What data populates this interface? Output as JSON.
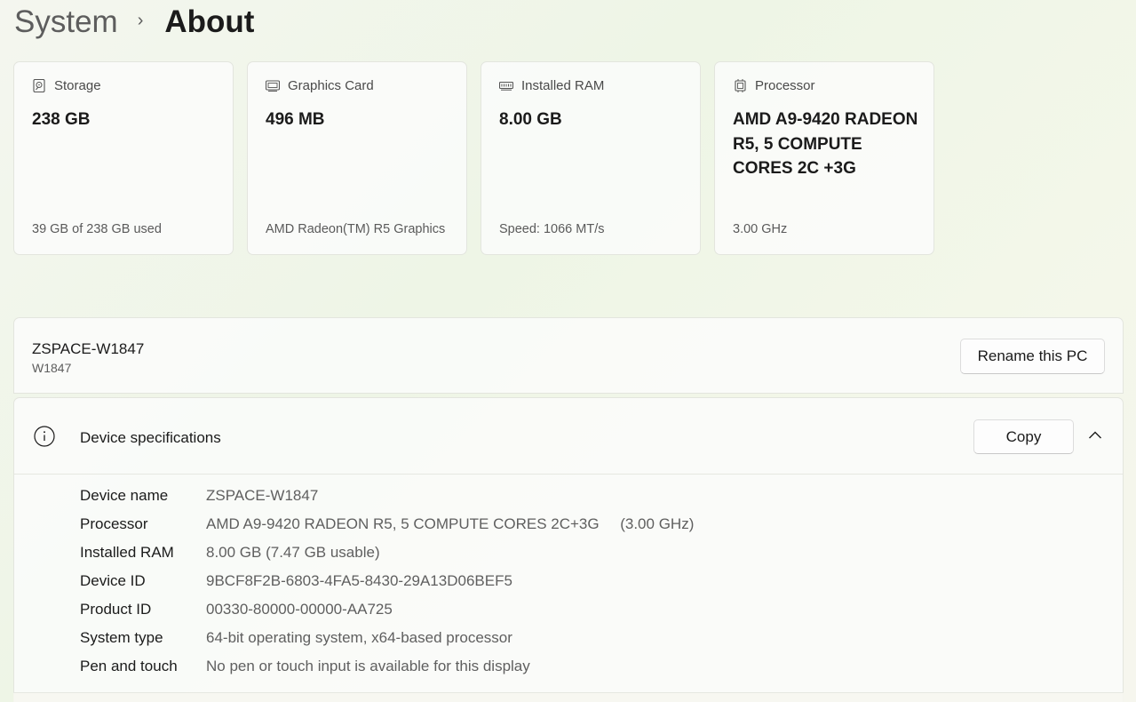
{
  "breadcrumb": {
    "parent": "System",
    "separator": "›",
    "current": "About"
  },
  "cards": [
    {
      "icon": "storage-icon",
      "title": "Storage",
      "value": "238 GB",
      "sub": "39 GB of 238 GB used"
    },
    {
      "icon": "graphics-card-icon",
      "title": "Graphics Card",
      "value": "496 MB",
      "sub": "AMD Radeon(TM) R5 Graphics"
    },
    {
      "icon": "ram-icon",
      "title": "Installed RAM",
      "value": "8.00 GB",
      "sub": "Speed: 1066 MT/s"
    },
    {
      "icon": "processor-icon",
      "title": "Processor",
      "value": "AMD A9-9420 RADEON R5, 5 COMPUTE CORES 2C +3G",
      "sub": "3.00 GHz"
    }
  ],
  "pc": {
    "name": "ZSPACE-W1847",
    "subtitle": "W1847",
    "rename_label": "Rename this PC"
  },
  "specs": {
    "title": "Device specifications",
    "copy_label": "Copy",
    "rows": [
      {
        "label": "Device name",
        "value": "ZSPACE-W1847"
      },
      {
        "label": "Processor",
        "value": "AMD A9-9420 RADEON R5, 5 COMPUTE CORES 2C+3G     (3.00 GHz)"
      },
      {
        "label": "Installed RAM",
        "value": "8.00 GB (7.47 GB usable)"
      },
      {
        "label": "Device ID",
        "value": "9BCF8F2B-6803-4FA5-8430-29A13D06BEF5"
      },
      {
        "label": "Product ID",
        "value": "00330-80000-00000-AA725"
      },
      {
        "label": "System type",
        "value": "64-bit operating system, x64-based processor"
      },
      {
        "label": "Pen and touch",
        "value": "No pen or touch input is available for this display"
      }
    ]
  }
}
